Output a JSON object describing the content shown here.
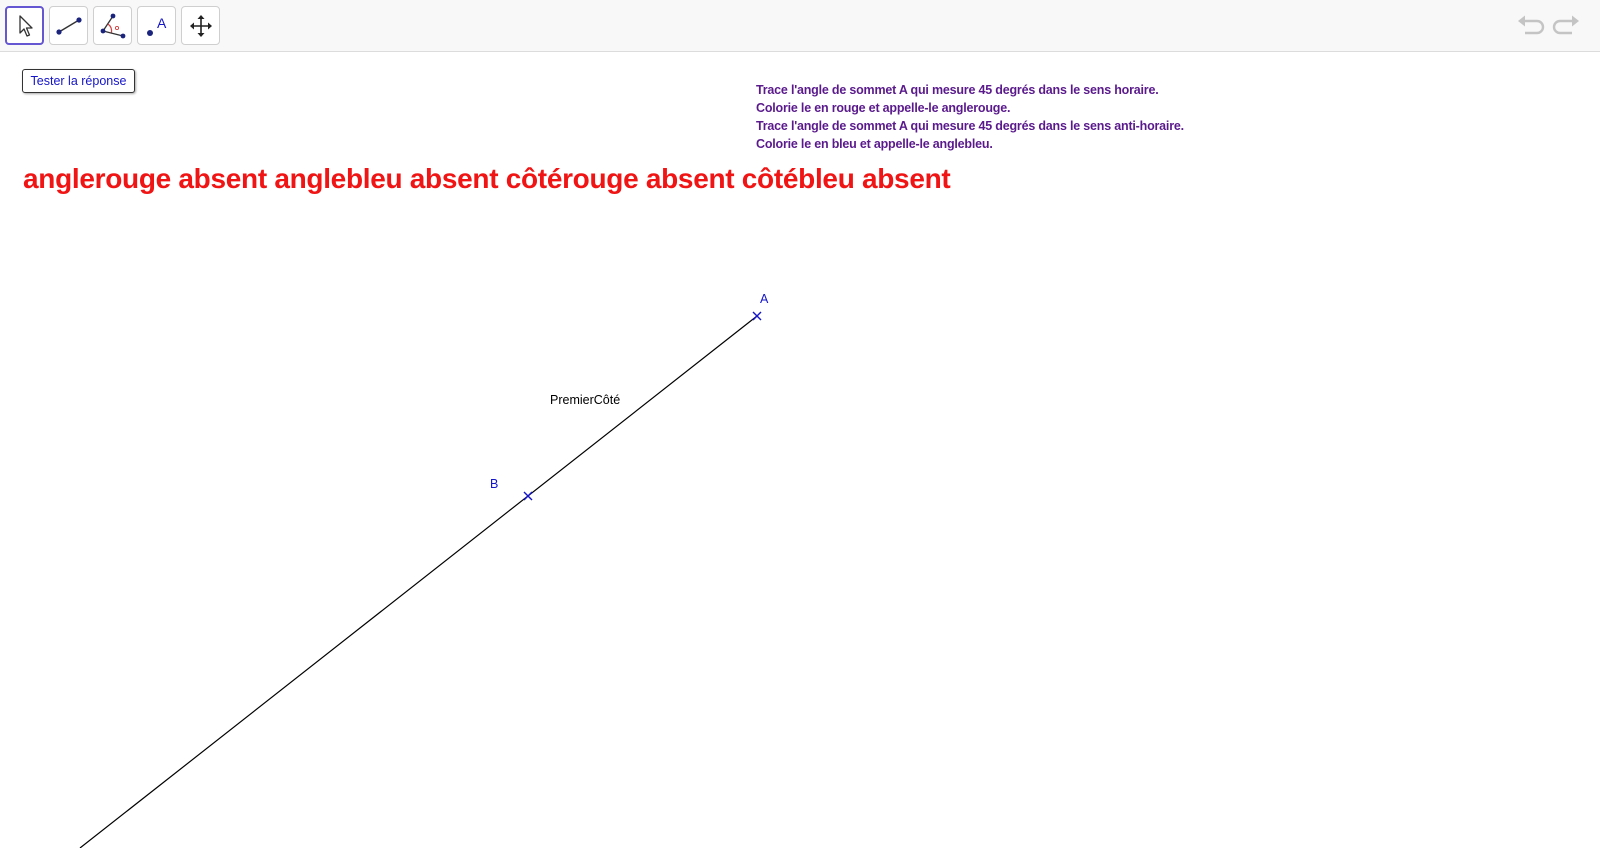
{
  "toolbar": {
    "tools": [
      {
        "name": "move",
        "icon": "cursor-arrow-icon",
        "active": true
      },
      {
        "name": "segment",
        "icon": "segment-icon",
        "active": false
      },
      {
        "name": "angle",
        "icon": "angle-icon",
        "active": false
      },
      {
        "name": "text",
        "icon": "text-label-icon",
        "active": false
      },
      {
        "name": "move-graphics-view",
        "icon": "move-arrows-icon",
        "active": false
      }
    ],
    "undo_icon": "undo-icon",
    "redo_icon": "redo-icon"
  },
  "test_button": {
    "label": "Tester la réponse"
  },
  "instructions": [
    "Trace l'angle de sommet A qui mesure 45 degrés dans le sens horaire.",
    "Colorie le en rouge et appelle-le anglerouge.",
    "Trace l'angle de sommet A qui mesure 45 degrés dans le sens anti-horaire.",
    "Colorie le en bleu et appelle-le anglebleu."
  ],
  "status_text": "anglerouge absent anglebleu absent côtérouge absent côtébleu absent",
  "geometry": {
    "point_a_label": "A",
    "point_b_label": "B",
    "segment_label": "PremierCôté"
  },
  "colors": {
    "accent": "#6557d2",
    "point": "#1414c8",
    "status": "#f01414",
    "instructions": "#5a1a8c"
  }
}
